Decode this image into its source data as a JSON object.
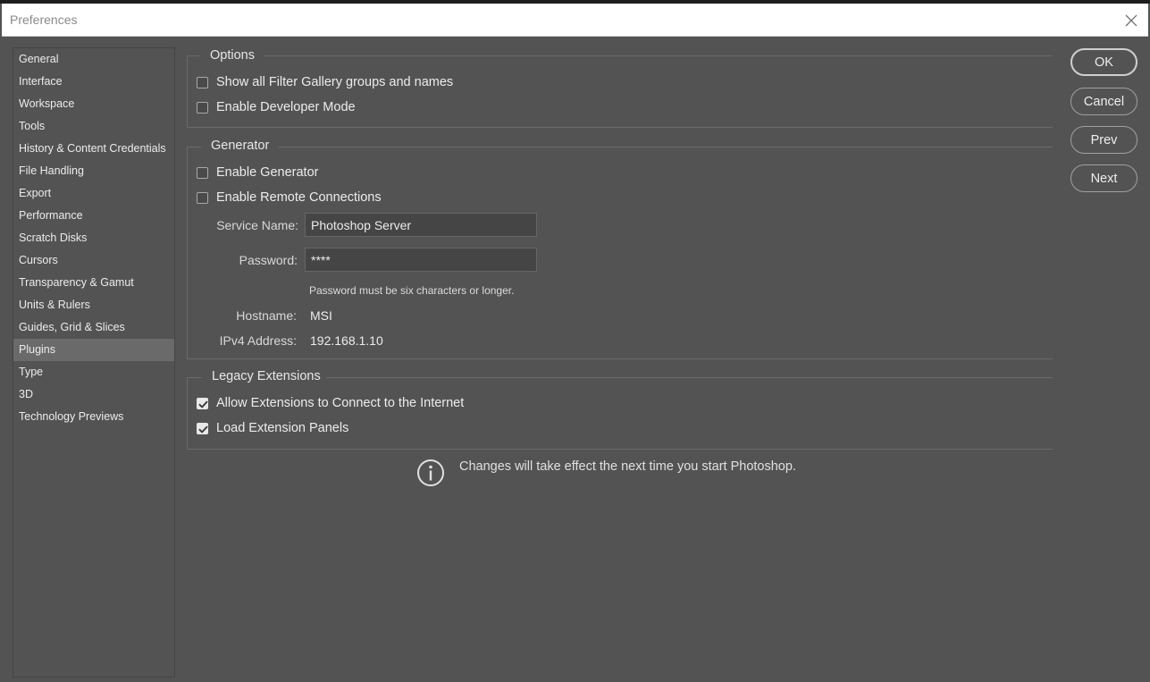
{
  "window": {
    "title": "Preferences",
    "close_icon": "close-icon"
  },
  "sidebar": {
    "items": [
      {
        "label": "General"
      },
      {
        "label": "Interface"
      },
      {
        "label": "Workspace"
      },
      {
        "label": "Tools"
      },
      {
        "label": "History & Content Credentials"
      },
      {
        "label": "File Handling"
      },
      {
        "label": "Export"
      },
      {
        "label": "Performance"
      },
      {
        "label": "Scratch Disks"
      },
      {
        "label": "Cursors"
      },
      {
        "label": "Transparency & Gamut"
      },
      {
        "label": "Units & Rulers"
      },
      {
        "label": "Guides, Grid & Slices"
      },
      {
        "label": "Plugins",
        "selected": true
      },
      {
        "label": "Type"
      },
      {
        "label": "3D"
      },
      {
        "label": "Technology Previews"
      }
    ]
  },
  "options": {
    "legend": "Options",
    "show_filter_gallery": {
      "label": "Show all Filter Gallery groups and names",
      "checked": false
    },
    "developer_mode": {
      "label": "Enable Developer Mode",
      "checked": false
    }
  },
  "generator": {
    "legend": "Generator",
    "enable_generator": {
      "label": "Enable Generator",
      "checked": false
    },
    "remote_connections": {
      "label": "Enable Remote Connections",
      "checked": false
    },
    "service_name": {
      "label": "Service Name:",
      "value": "Photoshop Server"
    },
    "password": {
      "label": "Password:",
      "value": "****",
      "hint": "Password must be six characters or longer."
    },
    "hostname": {
      "label": "Hostname:",
      "value": "MSI"
    },
    "ipv4": {
      "label": "IPv4 Address:",
      "value": "192.168.1.10"
    }
  },
  "legacy_extensions": {
    "legend": "Legacy Extensions",
    "connect_internet": {
      "label": "Allow Extensions to Connect to the Internet",
      "checked": true
    },
    "load_panels": {
      "label": "Load Extension Panels",
      "checked": true
    }
  },
  "notice": {
    "icon": "info-icon",
    "text": "Changes will take effect the next time you start Photoshop."
  },
  "buttons": {
    "ok": "OK",
    "cancel": "Cancel",
    "prev": "Prev",
    "next": "Next"
  },
  "colors": {
    "background": "#535353",
    "selected_item": "#6a6a6a",
    "title_bar": "#ffffff"
  }
}
